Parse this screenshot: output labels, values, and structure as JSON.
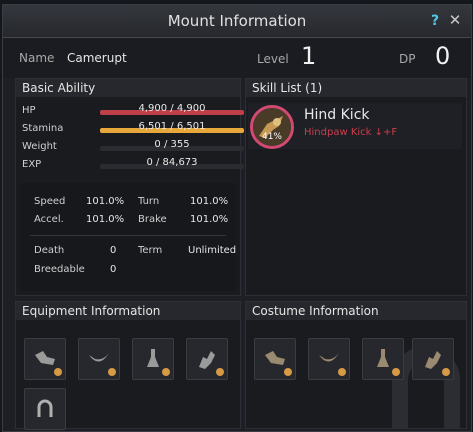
{
  "window": {
    "title": "Mount Information",
    "help_label": "?",
    "close_label": "✕"
  },
  "mount": {
    "name_label": "Name",
    "name": "Camerupt",
    "level_label": "Level",
    "level": "1",
    "dp_label": "DP",
    "dp": "0"
  },
  "basic": {
    "title": "Basic Ability",
    "bars": [
      {
        "label": "HP",
        "text": "4,900 / 4,900",
        "fill": 1.0,
        "color": "#c0404a"
      },
      {
        "label": "Stamina",
        "text": "6,501 / 6,501",
        "fill": 1.0,
        "color": "#e8a73b"
      },
      {
        "label": "Weight",
        "text": "0 / 355",
        "fill": 0.0,
        "color": "#888888"
      },
      {
        "label": "EXP",
        "text": "0 / 84,673",
        "fill": 0.0,
        "color": "#888888"
      }
    ],
    "speed_label": "Speed",
    "speed": "101.0%",
    "turn_label": "Turn",
    "turn": "101.0%",
    "accel_label": "Accel.",
    "accel": "101.0%",
    "brake_label": "Brake",
    "brake": "101.0%",
    "death_label": "Death",
    "death": "0",
    "term_label": "Term",
    "term": "Unlimited",
    "breedable_label": "Breedable",
    "breedable": "0"
  },
  "skills": {
    "title": "Skill List (1)",
    "items": [
      {
        "name": "Hind Kick",
        "command": "Hindpaw Kick ↓+F",
        "progress": "41%",
        "ring_color": "#d24a73"
      }
    ]
  },
  "equipment": {
    "title": "Equipment Information",
    "slots": [
      "horse-tack-icon",
      "saddle-icon",
      "stirrup-icon",
      "armor-icon",
      "horseshoe-icon"
    ]
  },
  "costume": {
    "title": "Costume Information",
    "slots": [
      "horse-tack-icon",
      "saddle-icon",
      "stirrup-icon",
      "armor-icon"
    ]
  },
  "colors": {
    "accent_orange": "#d69a45",
    "hp_red": "#c0404a",
    "stamina_yellow": "#e8a73b",
    "skill_red": "#cc3e4b"
  }
}
